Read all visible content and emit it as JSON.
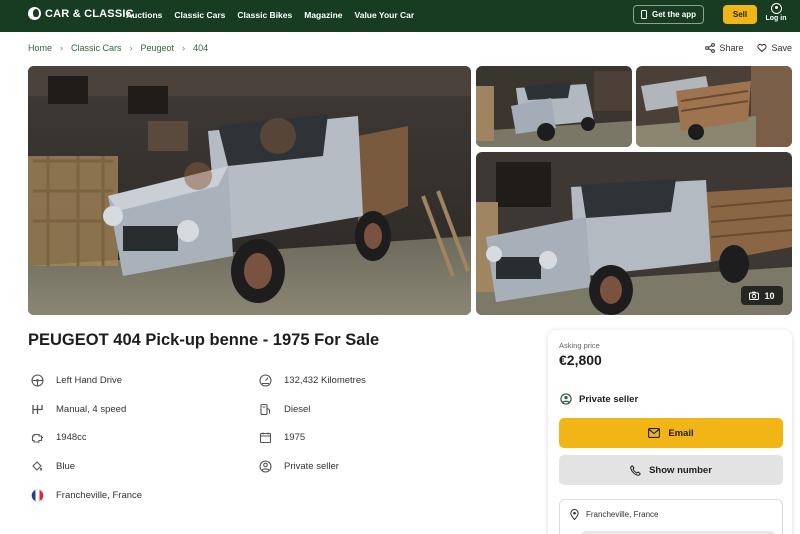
{
  "header": {
    "logo_text": "CAR & CLASSIC",
    "nav": [
      "Auctions",
      "Classic Cars",
      "Classic Bikes",
      "Magazine",
      "Value Your Car"
    ],
    "get_app": "Get the app",
    "sell": "Sell",
    "login": "Log in"
  },
  "breadcrumb": [
    "Home",
    "Classic Cars",
    "Peugeot",
    "404"
  ],
  "actions": {
    "share": "Share",
    "save": "Save"
  },
  "gallery": {
    "photo_count": "10"
  },
  "listing": {
    "title": "PEUGEOT 404 Pick-up benne - 1975 For Sale",
    "specs": [
      {
        "icon": "steering-wheel-icon",
        "text": "Left Hand Drive"
      },
      {
        "icon": "odometer-icon",
        "text": "132,432 Kilometres"
      },
      {
        "icon": "gearbox-icon",
        "text": "Manual, 4 speed"
      },
      {
        "icon": "fuel-pump-icon",
        "text": "Diesel"
      },
      {
        "icon": "engine-icon",
        "text": "1948cc"
      },
      {
        "icon": "calendar-icon",
        "text": "1975"
      },
      {
        "icon": "paint-bucket-icon",
        "text": "Blue"
      },
      {
        "icon": "user-icon",
        "text": "Private seller"
      },
      {
        "icon": "france-flag-icon",
        "text": "Francheville, France"
      }
    ]
  },
  "panel": {
    "asking_label": "Asking price",
    "price": "€2,800",
    "seller": "Private seller",
    "email": "Email",
    "show_number": "Show number",
    "location": "Francheville, France"
  },
  "colors": {
    "nav_bg": "#173c22",
    "accent_yellow": "#f1b516",
    "link_green": "#2f6a3a"
  }
}
